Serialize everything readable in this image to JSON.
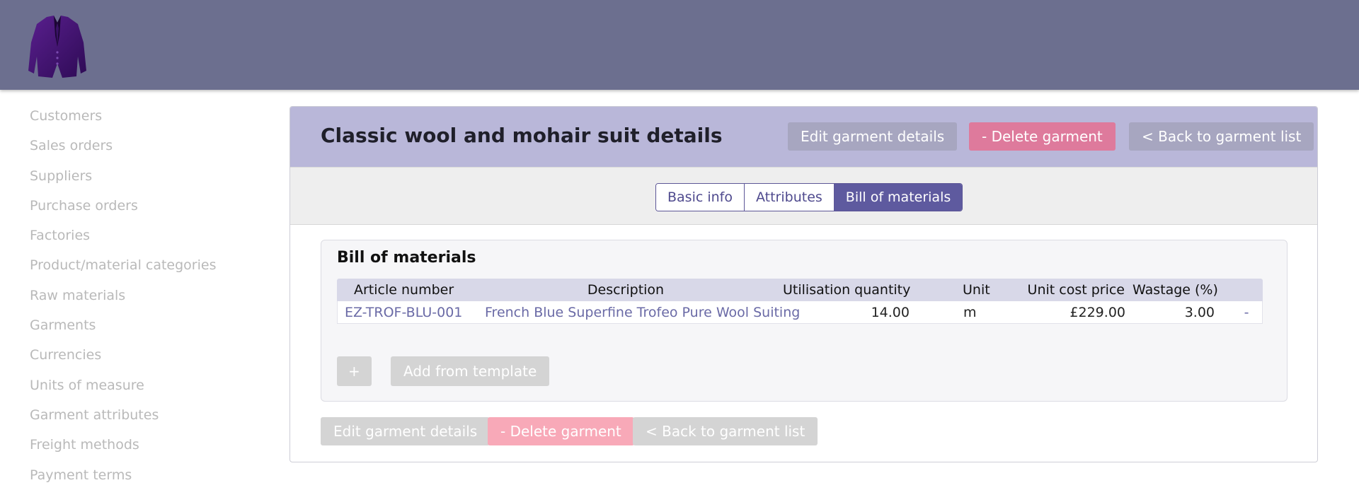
{
  "header": {
    "logo_icon": "suit-jacket-logo-icon",
    "background_color": "#6c6f8f"
  },
  "sidebar": {
    "items": [
      {
        "label": "Customers"
      },
      {
        "label": "Sales orders"
      },
      {
        "label": "Suppliers"
      },
      {
        "label": "Purchase orders"
      },
      {
        "label": "Factories"
      },
      {
        "label": "Product/material categories"
      },
      {
        "label": "Raw materials"
      },
      {
        "label": "Garments"
      },
      {
        "label": "Currencies"
      },
      {
        "label": "Units of measure"
      },
      {
        "label": "Garment attributes"
      },
      {
        "label": "Freight methods"
      },
      {
        "label": "Payment terms"
      }
    ]
  },
  "panel": {
    "title": "Classic wool and mohair suit details",
    "header_actions": {
      "edit": "Edit garment details",
      "delete": "- Delete garment",
      "back": "< Back to garment list"
    },
    "tabs": [
      {
        "label": "Basic info",
        "active": false
      },
      {
        "label": "Attributes",
        "active": false
      },
      {
        "label": "Bill of materials",
        "active": true
      }
    ],
    "bom": {
      "title": "Bill of materials",
      "columns": [
        "Article number",
        "Description",
        "Utilisation quantity",
        "Unit",
        "Unit cost price",
        "Wastage (%)"
      ],
      "rows": [
        {
          "article_number": "EZ-TROF-BLU-001",
          "description": "French Blue Superfine Trofeo Pure Wool Suiting",
          "utilisation_quantity": "14.00",
          "unit": "m",
          "unit_cost_price": "£229.00",
          "wastage": "3.00",
          "remove": "-"
        }
      ],
      "add_label": "+",
      "template_label": "Add from template"
    },
    "footer_actions": {
      "edit": "Edit garment details",
      "delete": "- Delete garment",
      "back": "< Back to garment list"
    }
  },
  "colors": {
    "accent": "#5e5a9f",
    "panel_header": "#b9b7d9",
    "danger": "#de7a9c",
    "link": "#6a6aa6"
  }
}
